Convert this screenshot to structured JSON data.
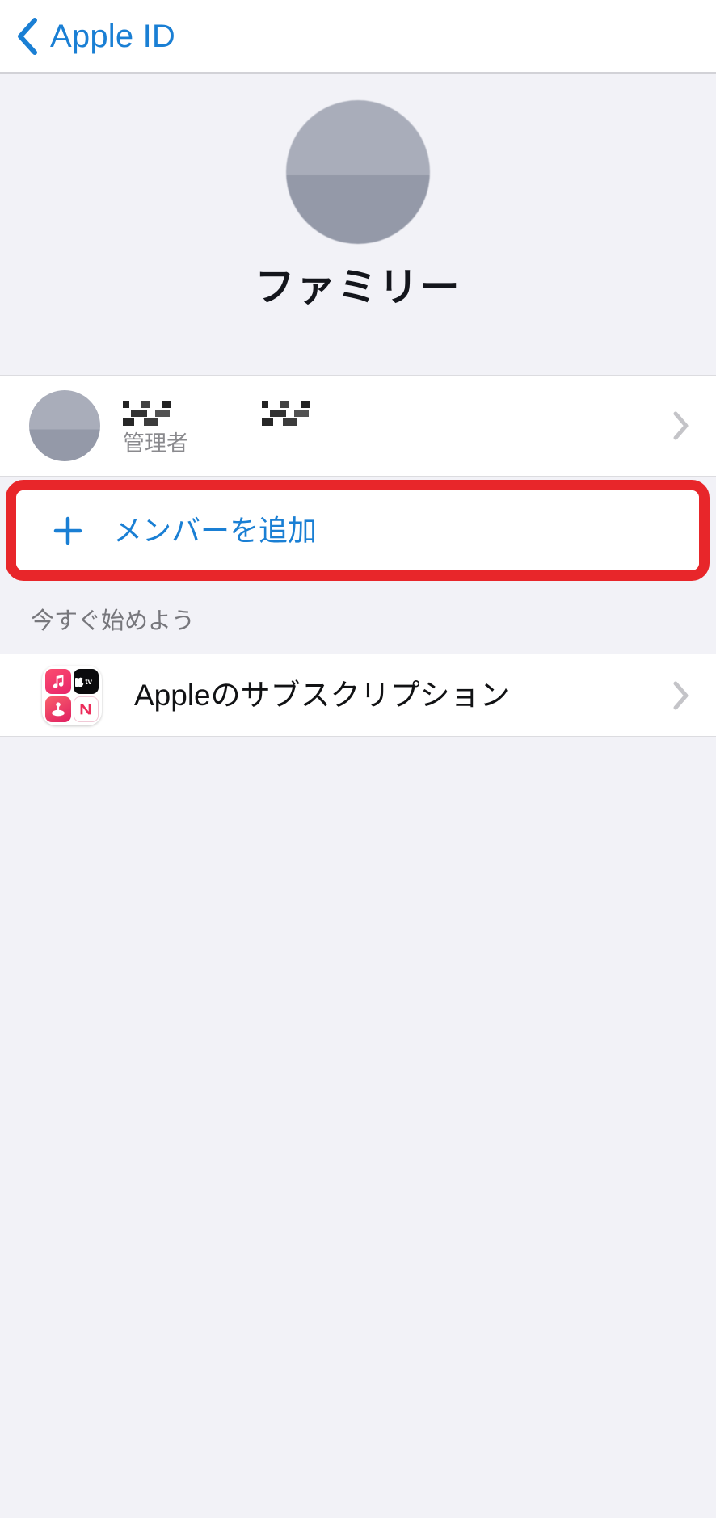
{
  "navbar": {
    "back_label": "Apple ID",
    "back_icon": "chevron-left-icon",
    "accent_color": "#1a7fd4"
  },
  "profile": {
    "avatar_icon": "person-placeholder-avatar",
    "name": "ファミリー"
  },
  "family_section": {
    "member": {
      "avatar_icon": "person-placeholder-avatar",
      "name_redacted": true,
      "role": "管理者",
      "chevron_icon": "chevron-right-icon"
    },
    "add_member": {
      "plus_icon": "plus-icon",
      "label": "メンバーを追加",
      "highlight_color": "#e8262a",
      "highlighted": true
    }
  },
  "get_started_section": {
    "header": "今すぐ始めよう",
    "items": [
      {
        "icon": "apple-services-grid-icon",
        "sub_icons": [
          "apple-music-icon",
          "apple-tv-icon",
          "apple-arcade-icon",
          "apple-news-icon"
        ],
        "label": "Appleのサブスクリプション",
        "chevron_icon": "chevron-right-icon"
      }
    ]
  },
  "colors": {
    "background": "#f2f2f7",
    "card": "#ffffff",
    "accent_blue": "#1a7fd4",
    "annotation_red": "#e8262a",
    "secondary_text": "#8a8a8e"
  }
}
